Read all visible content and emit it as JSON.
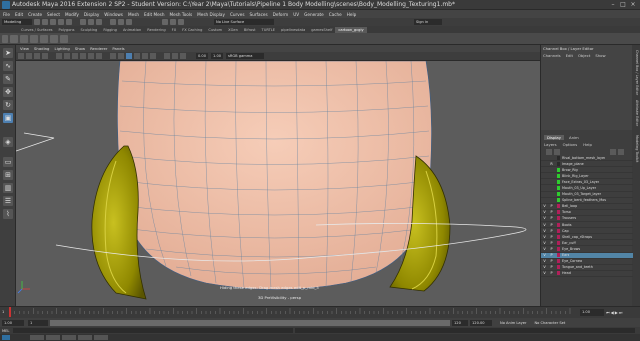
{
  "window": {
    "title": "Autodesk Maya 2016 Extension 2 SP2 - Student Version: C:\\Year 2\\Maya\\Tutorials\\Pipeline 1 Body Modelling\\scenes\\Body_Modelling_Texturing1.mb*"
  },
  "menubar": [
    "File",
    "Edit",
    "Create",
    "Select",
    "Modify",
    "Display",
    "Windows",
    "Mesh",
    "Edit Mesh",
    "Mesh Tools",
    "Mesh Display",
    "Curves",
    "Surfaces",
    "Deform",
    "UV",
    "Generate",
    "Cache",
    "Help"
  ],
  "statusline": {
    "mode": "Modeling",
    "no_live_surface": "No Live Surface",
    "sign_in": "Sign in"
  },
  "shelf_tabs": {
    "items": [
      "Curves / Surfaces",
      "Polygons",
      "Sculpting",
      "Rigging",
      "Animation",
      "Rendering",
      "FX",
      "FX Caching",
      "Custom",
      "XGen",
      "Bifrost",
      "TURTLE",
      "pipelinesdata",
      "gamesShelf",
      "cartoon_gcgiy"
    ],
    "active_index": 14
  },
  "panel_menu": [
    "View",
    "Shading",
    "Lighting",
    "Show",
    "Renderer",
    "Panels"
  ],
  "panel_tools": {
    "near_value": "0.00",
    "far_value": "1.00",
    "color_space": "sRGB gamma"
  },
  "viewport": {
    "hud_message": "Hiding these edges: Drag mesh edges edit_p_mid_5",
    "camera_label": "3D PreVisibility - persp"
  },
  "channel_box": {
    "title": "Channel Box / Layer Editor",
    "menu": [
      "Channels",
      "Edit",
      "Object",
      "Show"
    ]
  },
  "right_tabs": [
    "Channel Box / Layer Editor",
    "Attribute Editor",
    "Modeling Toolkit"
  ],
  "layer_editor": {
    "tabs": [
      "Display",
      "Anim"
    ],
    "active_tab": 0,
    "menu": [
      "Layers",
      "Options",
      "Help"
    ],
    "layers": [
      {
        "v": "",
        "p": "",
        "color": "#2a2a2a",
        "name": "Rival_bottom_mesh_layer",
        "selected": false
      },
      {
        "v": "",
        "p": "R",
        "color": "#2a2a2a",
        "name": "Image_plane",
        "selected": false
      },
      {
        "v": "",
        "p": "",
        "color": "#2ecc2e",
        "name": "Brow_Rig",
        "selected": false
      },
      {
        "v": "",
        "p": "",
        "color": "#2ecc2e",
        "name": "Blink_Rig_Layer",
        "selected": false
      },
      {
        "v": "",
        "p": "",
        "color": "#2ecc2e",
        "name": "Face_Extras_03_Layer",
        "selected": false
      },
      {
        "v": "",
        "p": "",
        "color": "#2ecc2e",
        "name": "Mouth_03_Up_Layer",
        "selected": false
      },
      {
        "v": "",
        "p": "",
        "color": "#2ecc2e",
        "name": "Mouth_03_Target_layer",
        "selected": false
      },
      {
        "v": "",
        "p": "",
        "color": "#2ecc2e",
        "name": "Spline_bent_feathers_Mov",
        "selected": false
      },
      {
        "v": "V",
        "p": "P",
        "color": "#b0205a",
        "name": "Bell_loop",
        "selected": false
      },
      {
        "v": "V",
        "p": "P",
        "color": "#b0205a",
        "name": "Torso",
        "selected": false
      },
      {
        "v": "V",
        "p": "P",
        "color": "#b0205a",
        "name": "Trousers",
        "selected": false
      },
      {
        "v": "V",
        "p": "P",
        "color": "#b0205a",
        "name": "Boots",
        "selected": false
      },
      {
        "v": "V",
        "p": "P",
        "color": "#b0205a",
        "name": "Cap",
        "selected": false
      },
      {
        "v": "V",
        "p": "P",
        "color": "#b0205a",
        "name": "Shell_cap_rStraps",
        "selected": false
      },
      {
        "v": "V",
        "p": "P",
        "color": "#b0205a",
        "name": "Ear_cuff",
        "selected": false
      },
      {
        "v": "V",
        "p": "P",
        "color": "#b0205a",
        "name": "Eye_Brows",
        "selected": false
      },
      {
        "v": "V",
        "p": "P",
        "color": "#b0205a",
        "name": "Ears",
        "selected": true
      },
      {
        "v": "V",
        "p": "P",
        "color": "#b0205a",
        "name": "Eye_Cornea",
        "selected": false
      },
      {
        "v": "V",
        "p": "P",
        "color": "#b0205a",
        "name": "Tongue_and_teeth",
        "selected": false
      },
      {
        "v": "V",
        "p": "P",
        "color": "#b0205a",
        "name": "Head",
        "selected": false
      }
    ]
  },
  "time_slider": {
    "start": "1",
    "current_frame": "1.00"
  },
  "range_slider": {
    "start": "1.00",
    "range_start": "1",
    "range_end": "120",
    "end": "120.00",
    "anim_layer": "No Anim Layer",
    "char_set": "No Character Set"
  },
  "command_line": {
    "label": "MEL"
  },
  "colors": {
    "skin": "#f2c2ac",
    "ear_yellow": "#a8a000",
    "wire": "#3a5f8a",
    "selected_layer": "#5285a6",
    "background": "#5c5c5c"
  }
}
